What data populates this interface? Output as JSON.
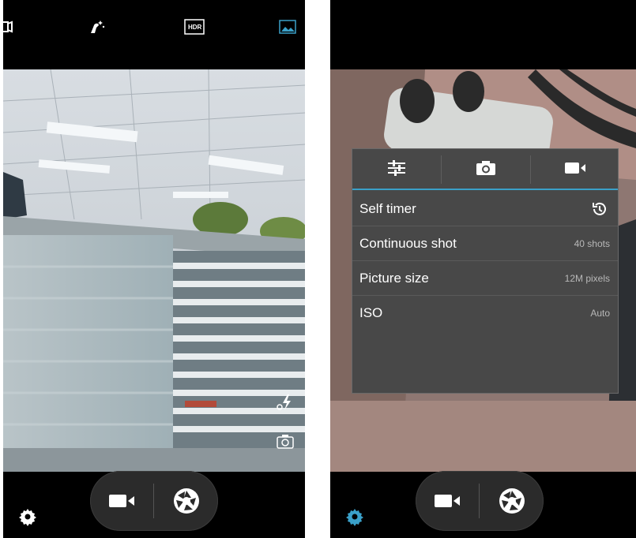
{
  "left_screen": {
    "top_icons": [
      "exit-panorama-icon",
      "face-beauty-icon",
      "hdr-icon",
      "gallery-icon"
    ],
    "hdr_label": "HDR",
    "side_icons": [
      "auto-flash-icon",
      "switch-camera-icon"
    ],
    "bottom": {
      "settings_icon": "gear-icon",
      "video_icon": "video-camera-icon",
      "shutter_icon": "shutter-icon"
    }
  },
  "right_screen": {
    "settings_panel": {
      "tabs": [
        {
          "icon": "sliders-icon"
        },
        {
          "icon": "photo-camera-icon",
          "selected": true
        },
        {
          "icon": "video-camera-icon"
        }
      ],
      "rows": [
        {
          "label": "Self timer",
          "value_icon": "timer-icon"
        },
        {
          "label": "Continuous shot",
          "value": "40 shots"
        },
        {
          "label": "Picture size",
          "value": "12M pixels"
        },
        {
          "label": "ISO",
          "value": "Auto"
        }
      ]
    },
    "bottom": {
      "settings_icon": "gear-icon",
      "video_icon": "video-camera-icon",
      "shutter_icon": "shutter-icon"
    }
  },
  "colors": {
    "accent": "#3aa0c8",
    "panel_bg": "#484848",
    "bar_bg": "#000000"
  }
}
